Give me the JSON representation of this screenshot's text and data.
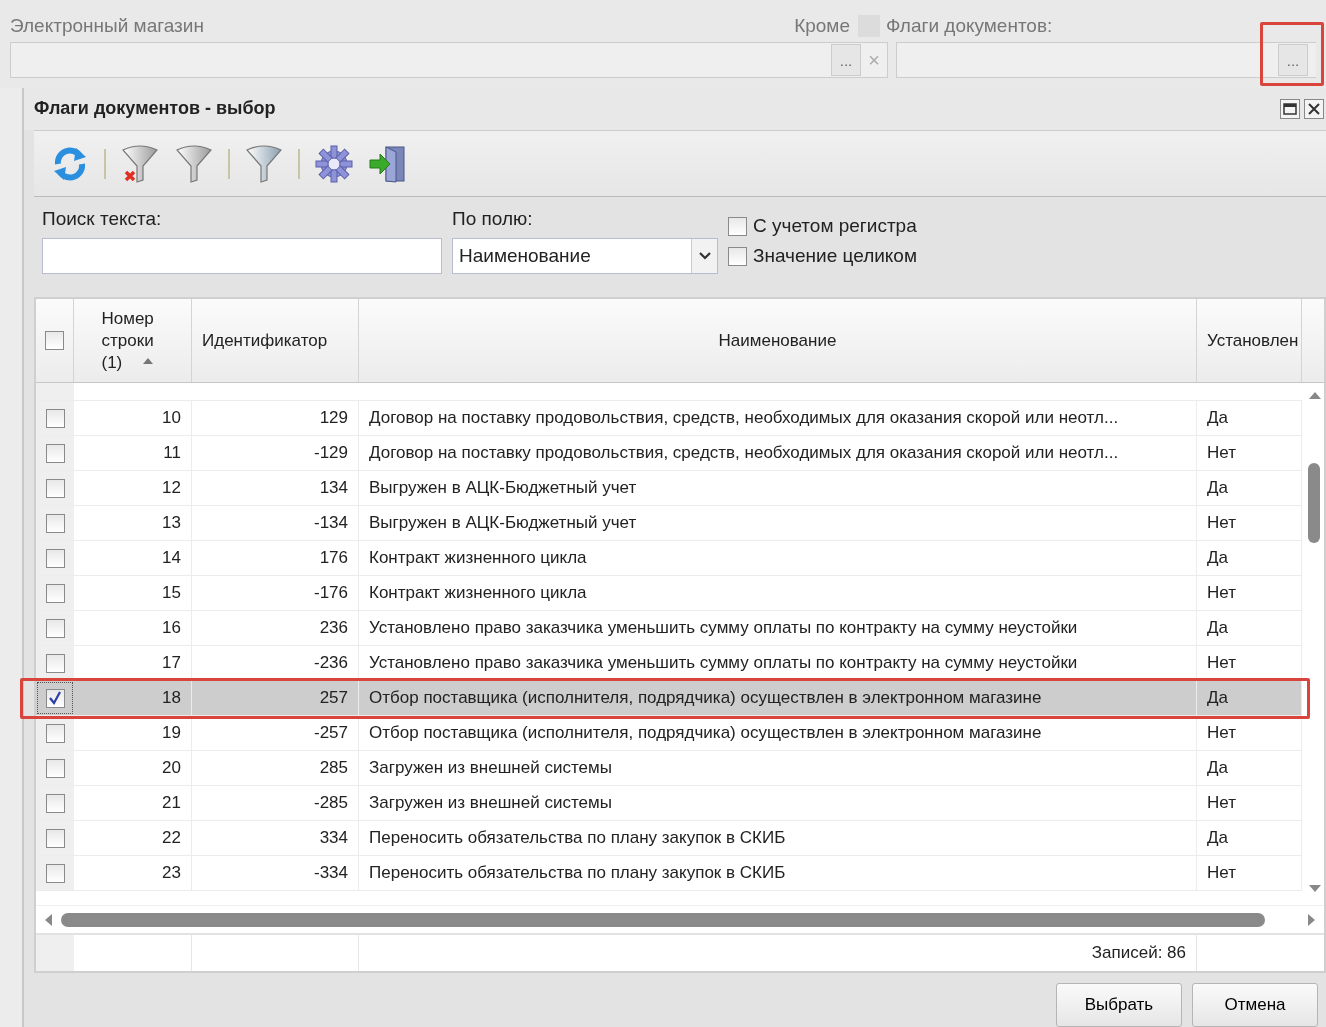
{
  "background_form": {
    "field_label": "Электронный магазин",
    "except_label": "Кроме",
    "except_checked": false,
    "flags_label": "Флаги документов:",
    "picker_button": "...",
    "clear_button": "×",
    "flags_picker_annotated": true
  },
  "dialog": {
    "title": "Флаги документов - выбор"
  },
  "toolbar": [
    {
      "kind": "refresh"
    },
    {
      "kind": "separator"
    },
    {
      "kind": "filter-clear"
    },
    {
      "kind": "filter"
    },
    {
      "kind": "separator"
    },
    {
      "kind": "filter-blue"
    },
    {
      "kind": "separator"
    },
    {
      "kind": "settings"
    },
    {
      "kind": "exit"
    }
  ],
  "search": {
    "label": "Поиск текста:"
  },
  "field_select": {
    "label": "По полю:",
    "value": "Наименование"
  },
  "options": [
    {
      "label": "С учетом регистра",
      "checked": false
    },
    {
      "label": "Значение целиком",
      "checked": false
    }
  ],
  "table": {
    "header_checked": false,
    "columns": [
      {
        "label": "Номер строки (1)",
        "sorted": true
      },
      {
        "label": "Идентификатор",
        "sorted": false
      },
      {
        "label": "Наименование",
        "sorted": false
      },
      {
        "label": "Установлен",
        "sorted": false
      }
    ],
    "rows": [
      {
        "number": "10",
        "id": "129",
        "name": "Договор на поставку продовольствия, средств, необходимых для оказания скорой или неотл...",
        "set": "Да",
        "checked": false,
        "selected": false,
        "annotated": false
      },
      {
        "number": "11",
        "id": "-129",
        "name": "Договор на поставку продовольствия, средств, необходимых для оказания скорой или неотл...",
        "set": "Нет",
        "checked": false,
        "selected": false,
        "annotated": false
      },
      {
        "number": "12",
        "id": "134",
        "name": "Выгружен в АЦК-Бюджетный учет",
        "set": "Да",
        "checked": false,
        "selected": false,
        "annotated": false
      },
      {
        "number": "13",
        "id": "-134",
        "name": "Выгружен в АЦК-Бюджетный учет",
        "set": "Нет",
        "checked": false,
        "selected": false,
        "annotated": false
      },
      {
        "number": "14",
        "id": "176",
        "name": "Контракт жизненного цикла",
        "set": "Да",
        "checked": false,
        "selected": false,
        "annotated": false
      },
      {
        "number": "15",
        "id": "-176",
        "name": "Контракт жизненного цикла",
        "set": "Нет",
        "checked": false,
        "selected": false,
        "annotated": false
      },
      {
        "number": "16",
        "id": "236",
        "name": "Установлено право заказчика уменьшить сумму оплаты по контракту на сумму неустойки",
        "set": "Да",
        "checked": false,
        "selected": false,
        "annotated": false
      },
      {
        "number": "17",
        "id": "-236",
        "name": "Установлено право заказчика уменьшить сумму оплаты по контракту на сумму неустойки",
        "set": "Нет",
        "checked": false,
        "selected": false,
        "annotated": false
      },
      {
        "number": "18",
        "id": "257",
        "name": "Отбор поставщика (исполнителя, подрядчика) осуществлен в электронном магазине",
        "set": "Да",
        "checked": true,
        "selected": true,
        "annotated": true
      },
      {
        "number": "19",
        "id": "-257",
        "name": "Отбор поставщика (исполнителя, подрядчика) осуществлен в электронном магазине",
        "set": "Нет",
        "checked": false,
        "selected": false,
        "annotated": false
      },
      {
        "number": "20",
        "id": "285",
        "name": "Загружен из внешней системы",
        "set": "Да",
        "checked": false,
        "selected": false,
        "annotated": false
      },
      {
        "number": "21",
        "id": "-285",
        "name": "Загружен из внешней системы",
        "set": "Нет",
        "checked": false,
        "selected": false,
        "annotated": false
      },
      {
        "number": "22",
        "id": "334",
        "name": "Переносить обязательства по плану закупок в СКИБ",
        "set": "Да",
        "checked": false,
        "selected": false,
        "annotated": false
      },
      {
        "number": "23",
        "id": "-334",
        "name": "Переносить обязательства по плану закупок в СКИБ",
        "set": "Нет",
        "checked": false,
        "selected": false,
        "annotated": false
      }
    ],
    "footer": "Записей: 86"
  },
  "buttons": [
    "Выбрать",
    "Отмена"
  ]
}
